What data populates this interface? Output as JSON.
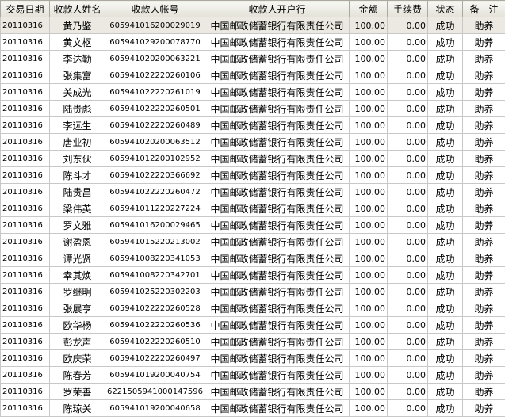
{
  "columns": [
    "交易日期",
    "收款人姓名",
    "收款人帐号",
    "收款人开户行",
    "金额",
    "手续费",
    "状态",
    "备　注"
  ],
  "rows": [
    [
      "20110316",
      "黄乃鉴",
      "605941016200029019",
      "中国邮政储蓄银行有限责任公司",
      "100.00",
      "0.00",
      "成功",
      "助养"
    ],
    [
      "20110316",
      "黄文枢",
      "605941029200078770",
      "中国邮政储蓄银行有限责任公司",
      "100.00",
      "0.00",
      "成功",
      "助养"
    ],
    [
      "20110316",
      "李达勤",
      "605941020200063221",
      "中国邮政储蓄银行有限责任公司",
      "100.00",
      "0.00",
      "成功",
      "助养"
    ],
    [
      "20110316",
      "张集富",
      "605941022220260106",
      "中国邮政储蓄银行有限责任公司",
      "100.00",
      "0.00",
      "成功",
      "助养"
    ],
    [
      "20110316",
      "关成光",
      "605941022220261019",
      "中国邮政储蓄银行有限责任公司",
      "100.00",
      "0.00",
      "成功",
      "助养"
    ],
    [
      "20110316",
      "陆贵彪",
      "605941022220260501",
      "中国邮政储蓄银行有限责任公司",
      "100.00",
      "0.00",
      "成功",
      "助养"
    ],
    [
      "20110316",
      "李远生",
      "605941022220260489",
      "中国邮政储蓄银行有限责任公司",
      "100.00",
      "0.00",
      "成功",
      "助养"
    ],
    [
      "20110316",
      "唐业初",
      "605941020200063512",
      "中国邮政储蓄银行有限责任公司",
      "100.00",
      "0.00",
      "成功",
      "助养"
    ],
    [
      "20110316",
      "刘东伙",
      "605941012200102952",
      "中国邮政储蓄银行有限责任公司",
      "100.00",
      "0.00",
      "成功",
      "助养"
    ],
    [
      "20110316",
      "陈斗才",
      "605941022220366692",
      "中国邮政储蓄银行有限责任公司",
      "100.00",
      "0.00",
      "成功",
      "助养"
    ],
    [
      "20110316",
      "陆贵昌",
      "605941022220260472",
      "中国邮政储蓄银行有限责任公司",
      "100.00",
      "0.00",
      "成功",
      "助养"
    ],
    [
      "20110316",
      "梁伟英",
      "605941011220227224",
      "中国邮政储蓄银行有限责任公司",
      "100.00",
      "0.00",
      "成功",
      "助养"
    ],
    [
      "20110316",
      "罗文雅",
      "605941016200029465",
      "中国邮政储蓄银行有限责任公司",
      "100.00",
      "0.00",
      "成功",
      "助养"
    ],
    [
      "20110316",
      "谢盈恩",
      "605941015220213002",
      "中国邮政储蓄银行有限责任公司",
      "100.00",
      "0.00",
      "成功",
      "助养"
    ],
    [
      "20110316",
      "谭光贤",
      "605941008220341053",
      "中国邮政储蓄银行有限责任公司",
      "100.00",
      "0.00",
      "成功",
      "助养"
    ],
    [
      "20110316",
      "幸其焕",
      "605941008220342701",
      "中国邮政储蓄银行有限责任公司",
      "100.00",
      "0.00",
      "成功",
      "助养"
    ],
    [
      "20110316",
      "罗继明",
      "605941025220302203",
      "中国邮政储蓄银行有限责任公司",
      "100.00",
      "0.00",
      "成功",
      "助养"
    ],
    [
      "20110316",
      "张展亨",
      "605941022220260528",
      "中国邮政储蓄银行有限责任公司",
      "100.00",
      "0.00",
      "成功",
      "助养"
    ],
    [
      "20110316",
      "欧华杨",
      "605941022220260536",
      "中国邮政储蓄银行有限责任公司",
      "100.00",
      "0.00",
      "成功",
      "助养"
    ],
    [
      "20110316",
      "彭龙声",
      "605941022220260510",
      "中国邮政储蓄银行有限责任公司",
      "100.00",
      "0.00",
      "成功",
      "助养"
    ],
    [
      "20110316",
      "欧庆荣",
      "605941022220260497",
      "中国邮政储蓄银行有限责任公司",
      "100.00",
      "0.00",
      "成功",
      "助养"
    ],
    [
      "20110316",
      "陈春芳",
      "605941019200040754",
      "中国邮政储蓄银行有限责任公司",
      "100.00",
      "0.00",
      "成功",
      "助养"
    ],
    [
      "20110316",
      "罗荣善",
      "6221505941000147596",
      "中国邮政储蓄银行有限责任公司",
      "100.00",
      "0.00",
      "成功",
      "助养"
    ],
    [
      "20110316",
      "陈琼关",
      "605941019200040658",
      "中国邮政储蓄银行有限责任公司",
      "100.00",
      "0.00",
      "成功",
      "助养"
    ]
  ],
  "colors": {
    "header_bg": "#ece9d8",
    "grid_line": "#c8c8c8",
    "selected_row": "#ebe9e1"
  }
}
